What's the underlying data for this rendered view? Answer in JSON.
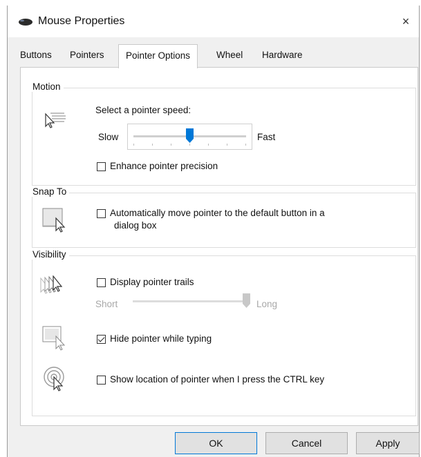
{
  "window": {
    "title": "Mouse Properties",
    "close_glyph": "×",
    "icon": "mouse-icon"
  },
  "tabs": [
    {
      "label": "Buttons",
      "active": false
    },
    {
      "label": "Pointers",
      "active": false
    },
    {
      "label": "Pointer Options",
      "active": true
    },
    {
      "label": "Wheel",
      "active": false
    },
    {
      "label": "Hardware",
      "active": false
    }
  ],
  "motion": {
    "group_label": "Motion",
    "speed_label": "Select a pointer speed:",
    "slow_label": "Slow",
    "fast_label": "Fast",
    "speed_value": 0.5,
    "precision_label": "Enhance pointer precision",
    "precision_checked": false
  },
  "snap": {
    "group_label": "Snap To",
    "auto_label_line1": "Automatically move pointer to the default button in a",
    "auto_label_line2": "dialog box",
    "auto_checked": false
  },
  "visibility": {
    "group_label": "Visibility",
    "trails_label": "Display pointer trails",
    "trails_checked": false,
    "short_label": "Short",
    "long_label": "Long",
    "trails_value": 1.0,
    "hide_label": "Hide pointer while typing",
    "hide_checked": true,
    "ctrl_label": "Show location of pointer when I press the CTRL key",
    "ctrl_checked": false
  },
  "buttons": {
    "ok": "OK",
    "cancel": "Cancel",
    "apply": "Apply"
  },
  "colors": {
    "accent": "#0078d7",
    "window_bg": "#f0f0f0",
    "panel_bg": "#ffffff"
  }
}
